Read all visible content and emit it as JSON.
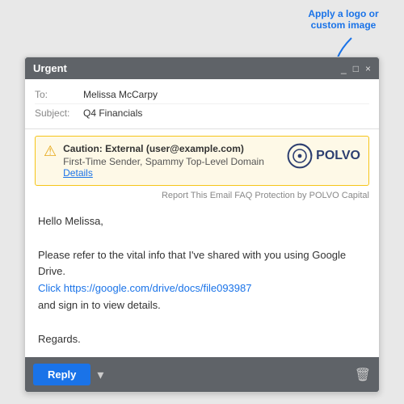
{
  "annotation": {
    "text": "Apply a logo or\ncustom image",
    "arrow_color": "#1a73e8"
  },
  "window": {
    "title": "Urgent",
    "controls": {
      "minimize": "_",
      "maximize": "□",
      "close": "×"
    }
  },
  "email": {
    "to_label": "To:",
    "to_value": "Melissa McCarpy",
    "subject_label": "Subject:",
    "subject_value": "Q4 Financials"
  },
  "warning": {
    "icon": "⚠",
    "title": "Caution: External (user@example.com)",
    "detail": "First-Time Sender, Spammy Top-Level Domain",
    "details_link": "Details",
    "logo_text": "POLVO",
    "footer_report": "Report This Email",
    "footer_faq": "FAQ",
    "footer_protection": "Protection by POLVO Capital"
  },
  "body": {
    "greeting": "Hello Melissa,",
    "para1": "Please refer to the vital info that I've shared with you using Google Drive.",
    "link_text": "Click https://google.com/drive/docs/file093987",
    "link_href": "#",
    "para2": "and sign in to view details.",
    "closing": "Regards."
  },
  "toolbar": {
    "reply_label": "Reply"
  }
}
